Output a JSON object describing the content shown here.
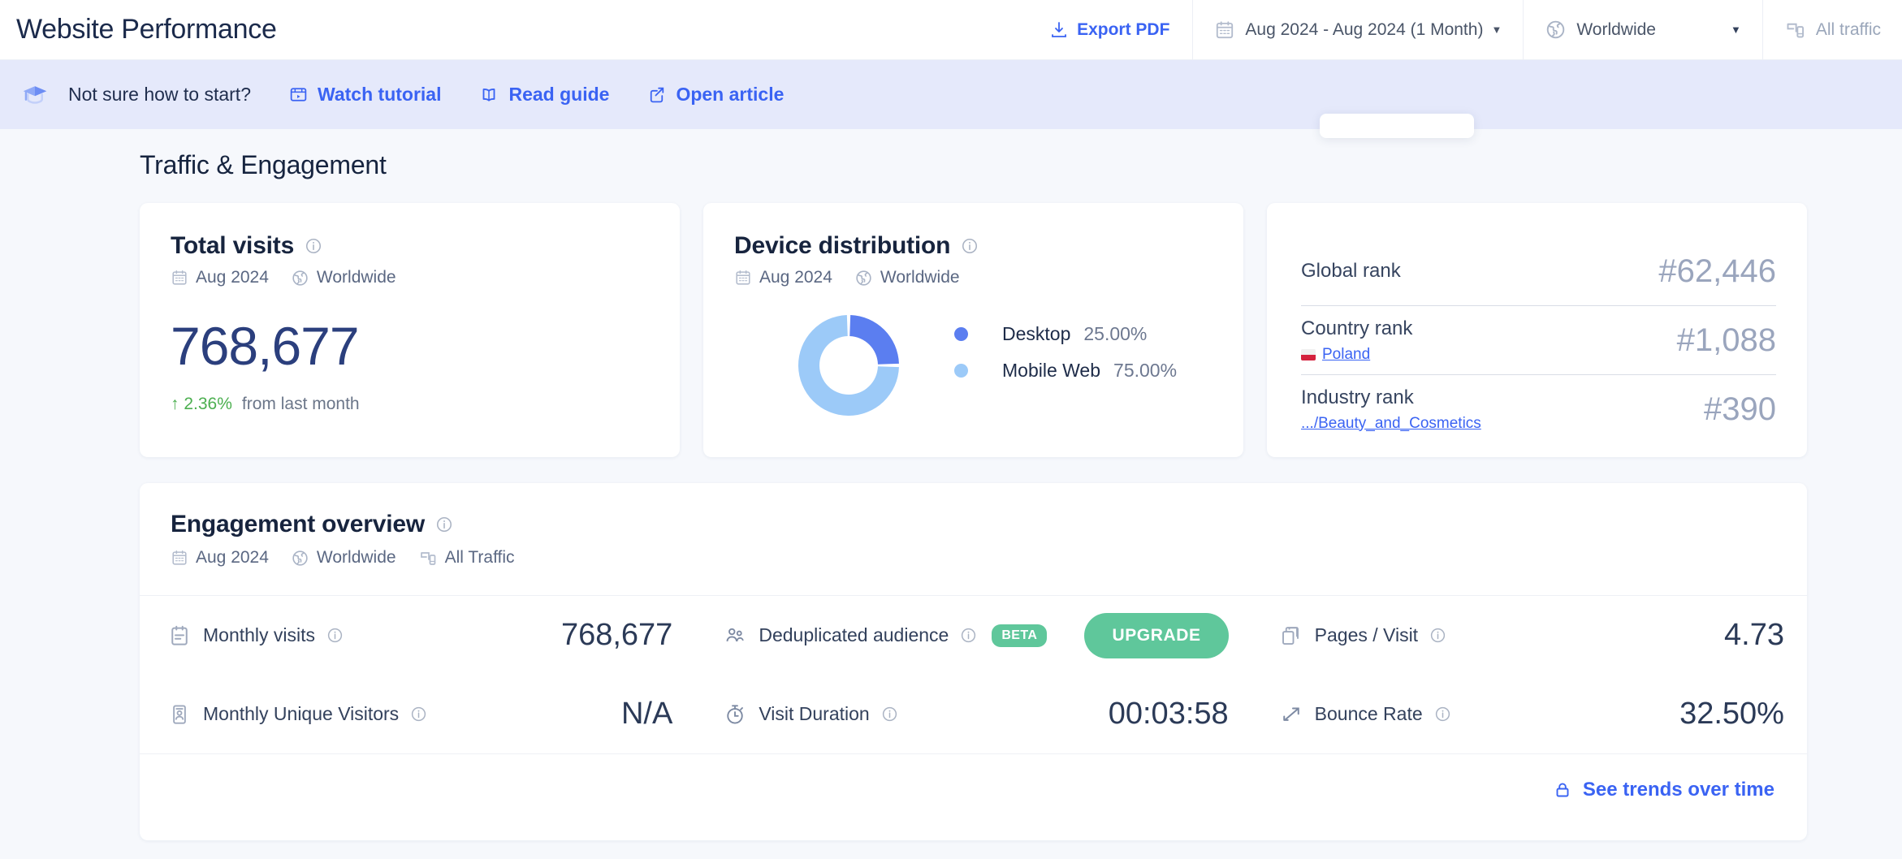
{
  "header": {
    "title": "Website Performance",
    "export_label": "Export PDF",
    "export_icon": "download-icon",
    "date_range": "Aug 2024 - Aug 2024 (1 Month)",
    "date_icon": "calendar-icon",
    "location": "Worldwide",
    "location_icon": "globe-icon",
    "traffic": "All traffic",
    "traffic_icon": "devices-icon"
  },
  "banner": {
    "icon": "graduation-cap-icon",
    "text": "Not sure how to start?",
    "links": [
      {
        "label": "Watch tutorial",
        "icon": "video-icon"
      },
      {
        "label": "Read guide",
        "icon": "book-icon"
      },
      {
        "label": "Open article",
        "icon": "external-link-icon"
      }
    ]
  },
  "section": {
    "title": "Traffic & Engagement"
  },
  "total_visits": {
    "title": "Total visits",
    "info_icon": "info-icon",
    "date": "Aug 2024",
    "location": "Worldwide",
    "value": "768,677",
    "delta_arrow": "↑",
    "delta": "2.36%",
    "delta_label": "from last month",
    "delta_color": "#4caf50"
  },
  "device_distribution": {
    "title": "Device distribution",
    "info_icon": "info-icon",
    "date": "Aug 2024",
    "location": "Worldwide"
  },
  "chart_data": {
    "type": "pie",
    "title": "Device distribution",
    "categories": [
      "Desktop",
      "Mobile Web"
    ],
    "values": [
      25.0,
      75.0
    ],
    "labels": [
      "25.00%",
      "75.00%"
    ],
    "colors": [
      "#5b7ef0",
      "#9ccaf8"
    ],
    "legend_position": "right",
    "donut": true
  },
  "ranks": [
    {
      "name": "Global rank",
      "value": "#62,446",
      "sub_link": null,
      "flag": null
    },
    {
      "name": "Country rank",
      "value": "#1,088",
      "sub_link": "Poland",
      "flag": "poland-flag"
    },
    {
      "name": "Industry rank",
      "value": "#390",
      "sub_link": ".../Beauty_and_Cosmetics",
      "flag": null
    }
  ],
  "engagement": {
    "title": "Engagement overview",
    "info_icon": "info-icon",
    "date": "Aug 2024",
    "location": "Worldwide",
    "traffic": "All Traffic",
    "metrics": [
      {
        "name": "Monthly visits",
        "icon": "calendar-metric-icon",
        "value": "768,677",
        "badge": null,
        "button": null
      },
      {
        "name": "Deduplicated audience",
        "icon": "users-icon",
        "value": null,
        "badge": "BETA",
        "button": "UPGRADE"
      },
      {
        "name": "Pages / Visit",
        "icon": "pages-icon",
        "value": "4.73",
        "badge": null,
        "button": null
      },
      {
        "name": "Monthly Unique Visitors",
        "icon": "visitor-icon",
        "value": "N/A",
        "badge": null,
        "button": null
      },
      {
        "name": "Visit Duration",
        "icon": "stopwatch-icon",
        "value": "00:03:58",
        "badge": null,
        "button": null
      },
      {
        "name": "Bounce Rate",
        "icon": "bounce-arrow-icon",
        "value": "32.50%",
        "badge": null,
        "button": null
      }
    ],
    "footer_link": "See trends over time",
    "footer_icon": "lock-icon"
  },
  "colors": {
    "accent_blue": "#3a63f3",
    "green": "#5fc79b",
    "banner_bg": "#e5e9fb",
    "page_bg": "#f6f8fc"
  }
}
